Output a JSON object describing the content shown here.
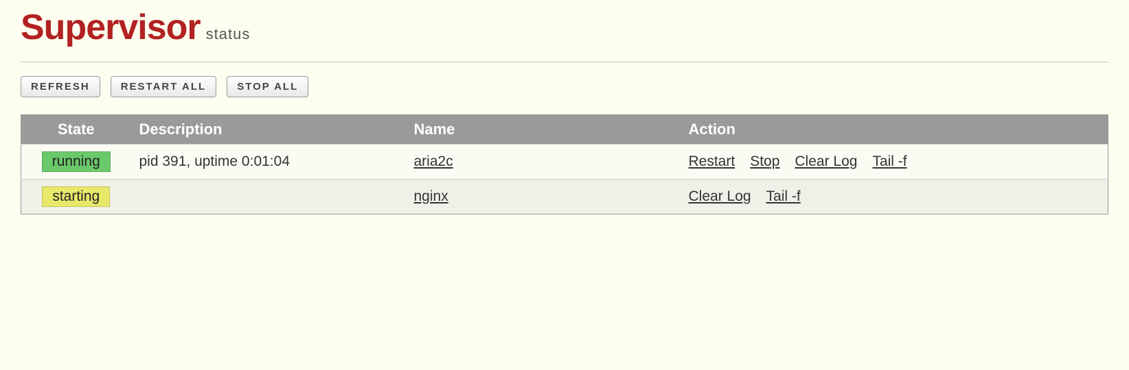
{
  "header": {
    "title": "Supervisor",
    "subtitle": "status"
  },
  "toolbar": {
    "refresh": "REFRESH",
    "restart_all": "RESTART ALL",
    "stop_all": "STOP ALL"
  },
  "table": {
    "headers": {
      "state": "State",
      "description": "Description",
      "name": "Name",
      "action": "Action"
    },
    "rows": [
      {
        "state": "running",
        "state_class": "state-running",
        "description": "pid 391, uptime 0:01:04",
        "name": "aria2c",
        "actions": [
          {
            "label": "Restart",
            "key": "restart"
          },
          {
            "label": "Stop",
            "key": "stop"
          },
          {
            "label": "Clear Log",
            "key": "clearlog"
          },
          {
            "label": "Tail -f",
            "key": "tailf"
          }
        ]
      },
      {
        "state": "starting",
        "state_class": "state-starting",
        "description": "",
        "name": "nginx",
        "actions": [
          {
            "label": "Clear Log",
            "key": "clearlog"
          },
          {
            "label": "Tail -f",
            "key": "tailf"
          }
        ]
      }
    ]
  }
}
